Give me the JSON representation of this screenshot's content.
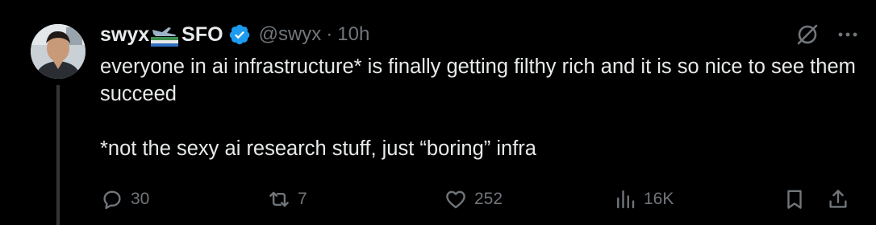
{
  "author": {
    "display_name": "swyx",
    "location_tag": "SFO",
    "handle": "@swyx",
    "separator": "·",
    "timestamp": "10h"
  },
  "body": {
    "line1": "everyone in ai infrastructure* is finally getting filthy rich and it is so nice to see them succeed",
    "line2": "*not the sexy ai research stuff, just “boring” infra"
  },
  "actions": {
    "replies": "30",
    "reposts": "7",
    "likes": "252",
    "views": "16K"
  },
  "colors": {
    "background": "#000000",
    "text_primary": "#e7e9ea",
    "text_secondary": "#71767b",
    "verified_blue": "#1d9bf0"
  },
  "icons": {
    "verified": "verified-badge-icon",
    "grok": "slashed-circle-icon",
    "more": "more-dots-icon",
    "reply": "speech-bubble-icon",
    "repost": "repost-arrows-icon",
    "like": "heart-icon",
    "views": "bar-chart-icon",
    "bookmark": "bookmark-icon",
    "share": "share-upload-icon"
  }
}
